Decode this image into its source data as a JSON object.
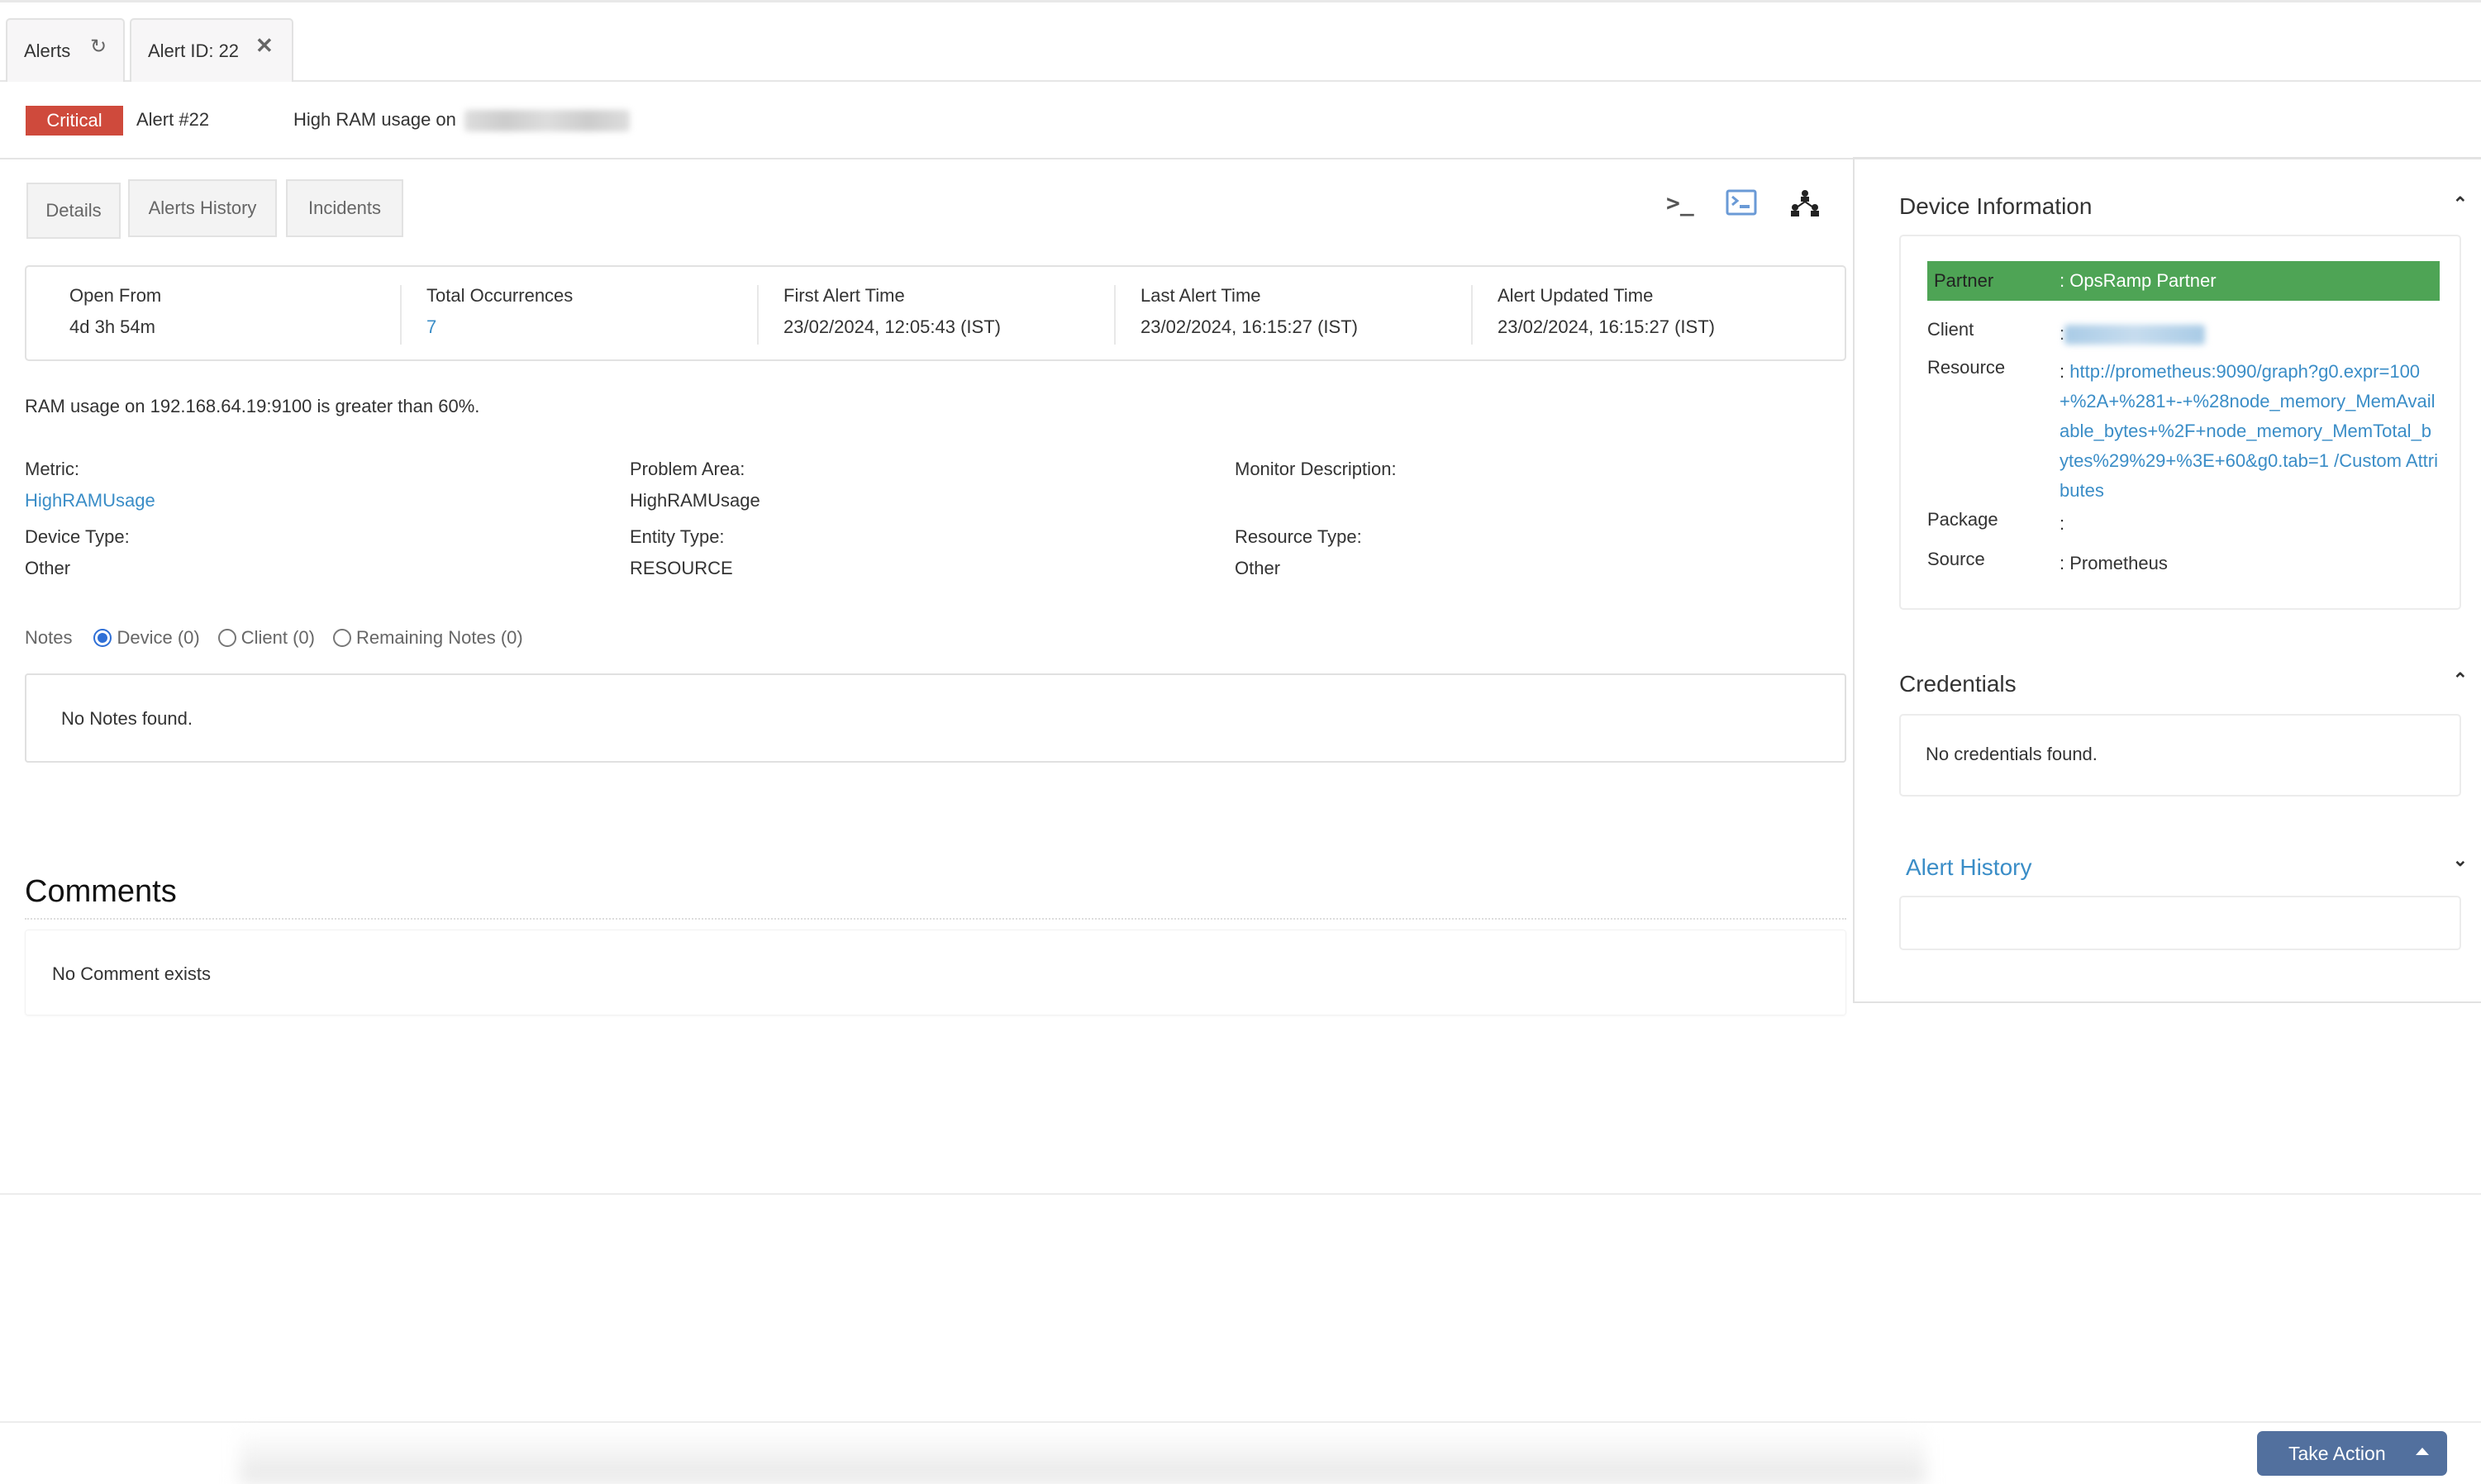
{
  "tabs": [
    {
      "label": "Alerts",
      "icon": "refresh-icon"
    },
    {
      "label": "Alert ID: 22",
      "icon": "close-icon"
    }
  ],
  "alert": {
    "severity": "Critical",
    "severity_color": "#cf4a3c",
    "number": "Alert #22",
    "title": "High RAM usage on"
  },
  "subtabs": [
    "Details",
    "Alerts History",
    "Incidents"
  ],
  "toolbar": {
    "icons": [
      "terminal-icon",
      "console-window-icon",
      "topology-icon"
    ]
  },
  "stats": [
    {
      "label": "Open From",
      "value": "4d 3h 54m"
    },
    {
      "label": "Total Occurrences",
      "value": "7"
    },
    {
      "label": "First Alert Time",
      "value": "23/02/2024, 12:05:43 (IST)"
    },
    {
      "label": "Last Alert Time",
      "value": "23/02/2024, 16:15:27 (IST)"
    },
    {
      "label": "Alert Updated Time",
      "value": "23/02/2024, 16:15:27 (IST)"
    }
  ],
  "description": "RAM usage on 192.168.64.19:9100 is greater than 60%.",
  "fields": {
    "metric": {
      "label": "Metric:",
      "value": "HighRAMUsage"
    },
    "problem_area": {
      "label": "Problem Area:",
      "value": "HighRAMUsage"
    },
    "monitor_description": {
      "label": "Monitor Description:",
      "value": ""
    },
    "device_type": {
      "label": "Device Type:",
      "value": "Other"
    },
    "entity_type": {
      "label": "Entity Type:",
      "value": "RESOURCE"
    },
    "resource_type": {
      "label": "Resource Type:",
      "value": "Other"
    }
  },
  "notes": {
    "label": "Notes",
    "options": [
      {
        "label": "Device (0)",
        "selected": true
      },
      {
        "label": "Client (0)",
        "selected": false
      },
      {
        "label": "Remaining Notes (0)",
        "selected": false
      }
    ],
    "empty_text": "No Notes found."
  },
  "comments": {
    "title": "Comments",
    "empty_text": "No Comment exists"
  },
  "sidebar": {
    "device_info": {
      "title": "Device Information",
      "rows": [
        {
          "key": "Partner",
          "value": ": OpsRamp Partner"
        },
        {
          "key": "Client",
          "value": ":"
        },
        {
          "key": "Resource",
          "value": "http://prometheus:9090/graph?g0.expr=100+%2A+%281+-+%28node_memory_MemAvailable_bytes+%2F+node_memory_MemTotal_bytes%29%29+%3E+60&g0.tab=1  /Custom Attributes"
        },
        {
          "key": "Package",
          "value": ":"
        },
        {
          "key": "Source",
          "value": ": Prometheus"
        }
      ],
      "partner_color": "#4ea455"
    },
    "credentials": {
      "title": "Credentials",
      "empty_text": "No credentials found."
    },
    "alert_history": {
      "title": "Alert History"
    }
  },
  "footer": {
    "take_action_label": "Take Action",
    "button_color": "#52709e"
  }
}
